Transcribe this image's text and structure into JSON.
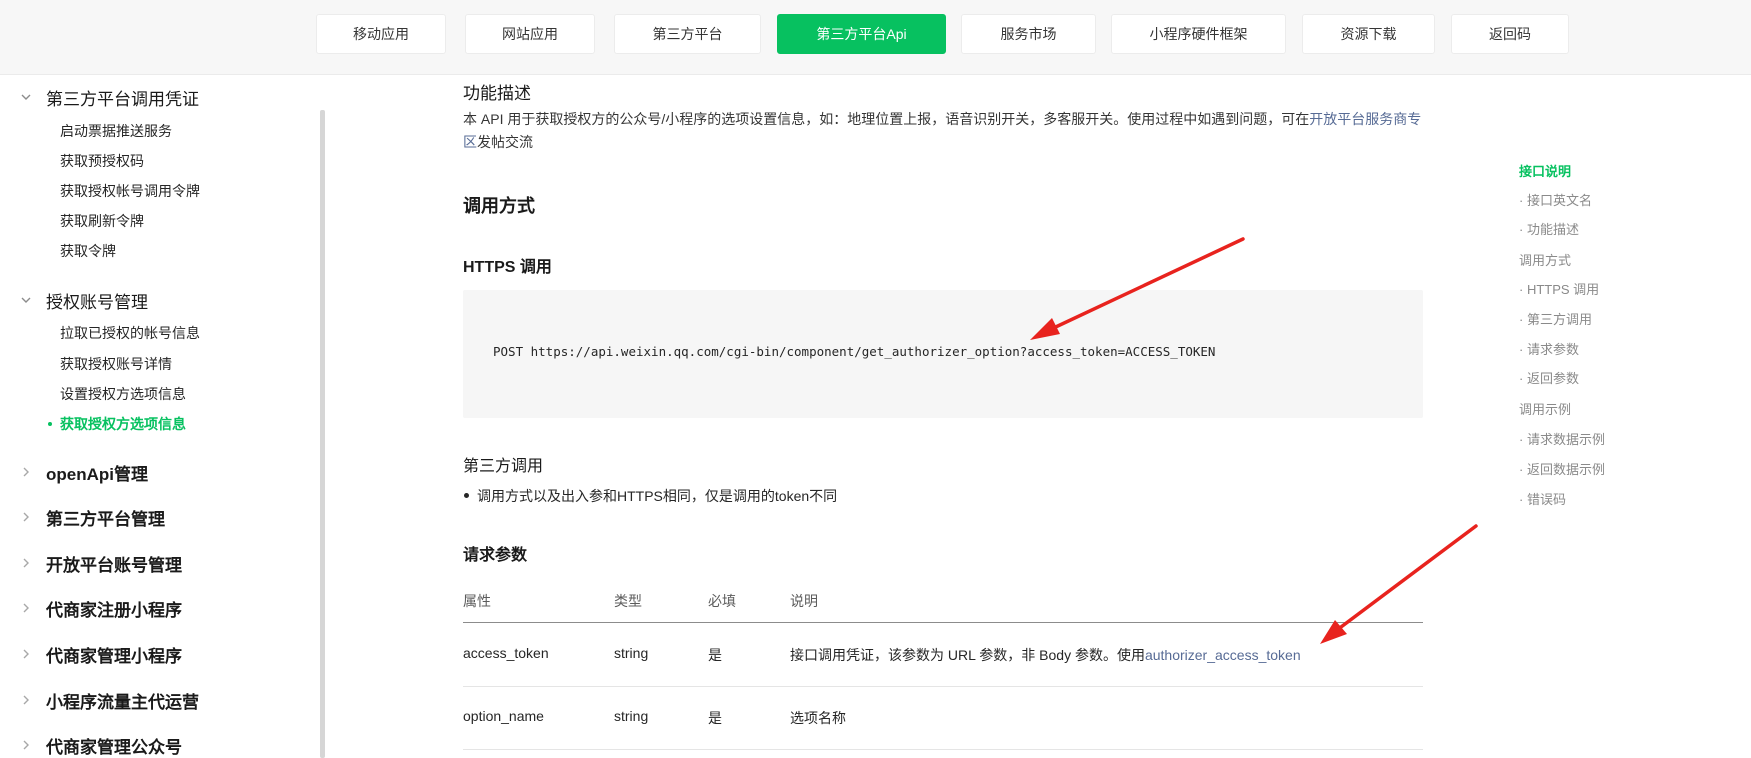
{
  "nav": {
    "tabs": [
      {
        "label": "移动应用"
      },
      {
        "label": "网站应用"
      },
      {
        "label": "第三方平台"
      },
      {
        "label": "第三方平台Api"
      },
      {
        "label": "服务市场"
      },
      {
        "label": "小程序硬件框架"
      },
      {
        "label": "资源下载"
      },
      {
        "label": "返回码"
      }
    ],
    "active_tab": "第三方平台Api"
  },
  "sidebar": {
    "groups": [
      {
        "label": "第三方平台调用凭证",
        "expanded": true,
        "items": [
          "启动票据推送服务",
          "获取预授权码",
          "获取授权帐号调用令牌",
          "获取刷新令牌",
          "获取令牌"
        ]
      },
      {
        "label": "授权账号管理",
        "expanded": true,
        "items": [
          "拉取已授权的帐号信息",
          "获取授权账号详情",
          "设置授权方选项信息",
          "获取授权方选项信息"
        ]
      },
      {
        "label": "openApi管理",
        "expanded": false
      },
      {
        "label": "第三方平台管理",
        "expanded": false
      },
      {
        "label": "开放平台账号管理",
        "expanded": false
      },
      {
        "label": "代商家注册小程序",
        "expanded": false
      },
      {
        "label": "代商家管理小程序",
        "expanded": false
      },
      {
        "label": "小程序流量主代运营",
        "expanded": false
      },
      {
        "label": "代商家管理公众号",
        "expanded": false
      }
    ],
    "active_item": "获取授权方选项信息"
  },
  "content": {
    "func_title": "功能描述",
    "desc_text": "本 API 用于获取授权方的公众号/小程序的选项设置信息，如：地理位置上报，语音识别开关，多客服开关。使用过程中如遇到问题，可在",
    "desc_link": "开放平台服务商专区",
    "desc_tail": "发帖交流",
    "call_title": "调用方式",
    "https_title": "HTTPS 调用",
    "https_code": "POST https://api.weixin.qq.com/cgi-bin/component/get_authorizer_option?access_token=ACCESS_TOKEN",
    "third_title": "第三方调用",
    "third_bullet": "调用方式以及出入参和HTTPS相同，仅是调用的token不同",
    "params_title": "请求参数",
    "params_headers": [
      "属性",
      "类型",
      "必填",
      "说明"
    ],
    "params_rows": [
      {
        "name": "access_token",
        "type": "string",
        "required": "是",
        "desc": "接口调用凭证，该参数为 URL 参数，非 Body 参数。使用",
        "desc_link": "authorizer_access_token"
      },
      {
        "name": "option_name",
        "type": "string",
        "required": "是",
        "desc": "选项名称",
        "desc_link": ""
      }
    ]
  },
  "toc": {
    "items": [
      {
        "label": "接口说明",
        "level": 1,
        "active": true
      },
      {
        "label": "· 接口英文名",
        "level": 2
      },
      {
        "label": "· 功能描述",
        "level": 2
      },
      {
        "label": "调用方式",
        "level": 1
      },
      {
        "label": "· HTTPS 调用",
        "level": 2
      },
      {
        "label": "· 第三方调用",
        "level": 2
      },
      {
        "label": "· 请求参数",
        "level": 2
      },
      {
        "label": "· 返回参数",
        "level": 2
      },
      {
        "label": "调用示例",
        "level": 1
      },
      {
        "label": "· 请求数据示例",
        "level": 2
      },
      {
        "label": "· 返回数据示例",
        "level": 2
      },
      {
        "label": "· 错误码",
        "level": 2
      }
    ]
  },
  "colors": {
    "accent": "#07c160",
    "link": "#576b95",
    "annotation_arrow": "#e8231e"
  }
}
